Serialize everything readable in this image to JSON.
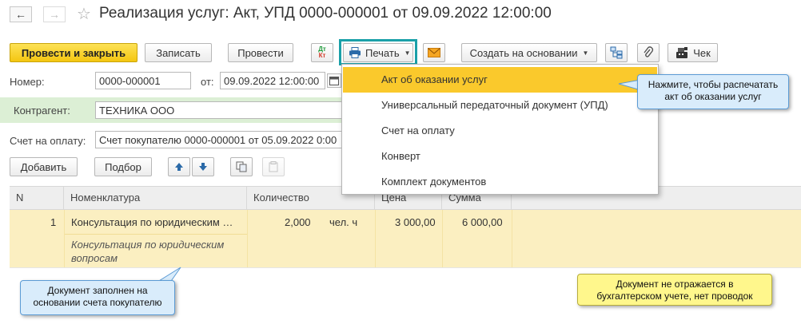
{
  "window": {
    "title": "Реализация услуг: Акт, УПД 0000-000001 от 09.09.2022 12:00:00",
    "back_glyph": "←",
    "forward_glyph": "→",
    "favorite_glyph": "☆"
  },
  "toolbar": {
    "post_and_close": "Провести и закрыть",
    "write": "Записать",
    "post": "Провести",
    "dt_kt_icon": {
      "top": "Дт",
      "bottom": "Кт"
    },
    "print": "Печать",
    "create_based_on": "Создать на основании",
    "receipt": "Чек"
  },
  "form": {
    "number_label": "Номер:",
    "number_value": "0000-000001",
    "date_label": "от:",
    "date_value": "09.09.2022 12:00:00",
    "counterparty_label": "Контрагент:",
    "counterparty_value": "ТЕХНИКА ООО",
    "invoice_label": "Счет на оплату:",
    "invoice_value": "Счет покупателю 0000-000001 от 05.09.2022 0:00"
  },
  "table_toolbar": {
    "add": "Добавить",
    "select": "Подбор"
  },
  "table": {
    "columns": [
      "N",
      "Номенклатура",
      "Количество",
      "Цена",
      "Сумма"
    ],
    "rows": [
      {
        "n": "1",
        "item": "Консультация по юридическим …",
        "quantity": "2,000",
        "unit": "чел. ч",
        "price": "3 000,00",
        "sum": "6 000,00",
        "content_line1": "Консультация по юридическим",
        "content_line2": "вопросам"
      }
    ]
  },
  "print_menu": {
    "items": [
      "Акт об оказании услуг",
      "Универсальный передаточный документ (УПД)",
      "Счет на оплату",
      "Конверт",
      "Комплект документов"
    ],
    "selected_index": 0
  },
  "callouts": {
    "print_hint": [
      "Нажмите, чтобы распечатать",
      "акт об оказании услуг"
    ],
    "filled_hint": [
      "Документ заполнен на",
      "основании счета покупателю"
    ],
    "accounting_hint": [
      "Документ не отражается в",
      "бухгалтерском учете, нет проводок"
    ]
  },
  "colors": {
    "primary_button": "#f4c611",
    "selected_menu_item": "#fac92c",
    "row_highlight": "#fbefc1",
    "counterparty_row": "#dcefd5",
    "callout_blue": "#d9ecfb",
    "callout_yellow": "#fff78c",
    "print_button_frame": "#1aa0a8"
  }
}
